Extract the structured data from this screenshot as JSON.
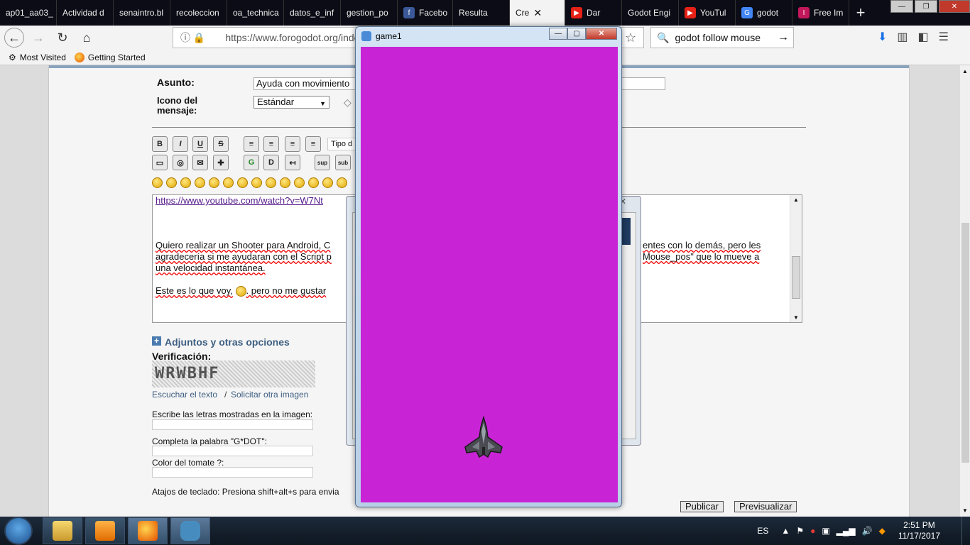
{
  "browser": {
    "tabs": [
      {
        "label": "ap01_aa03_",
        "icon": "",
        "color": "#0c0c16"
      },
      {
        "label": "Actividad d",
        "icon": "",
        "color": "#0c0c16"
      },
      {
        "label": "senaintro.bl",
        "icon": "",
        "color": "#0c0c16"
      },
      {
        "label": "recoleccion",
        "icon": "",
        "color": "#0c0c16"
      },
      {
        "label": "oa_technica",
        "icon": "",
        "color": "#0c0c16"
      },
      {
        "label": "datos_e_inf",
        "icon": "",
        "color": "#0c0c16"
      },
      {
        "label": "gestion_po",
        "icon": "",
        "color": "#0c0c16"
      },
      {
        "label": "Facebo",
        "icon": "f",
        "color": "#3b5998"
      },
      {
        "label": "Resulta",
        "icon": "",
        "color": "#478cbf"
      },
      {
        "label": "Cre",
        "icon": "",
        "color": "#478cbf"
      },
      {
        "label": "Dar",
        "icon": "▶",
        "color": "#e62117"
      },
      {
        "label": "Godot Engi",
        "icon": "",
        "color": "#0c0c16"
      },
      {
        "label": "YouTul",
        "icon": "▶",
        "color": "#e62117"
      },
      {
        "label": "godot",
        "icon": "G",
        "color": "#4285f4"
      },
      {
        "label": "Free Im",
        "icon": "I",
        "color": "#c2185b"
      }
    ],
    "new_tab": "+",
    "url": "https://www.forogodot.org/index.",
    "search_value": "godot follow mouse",
    "bookmarks": [
      "Most Visited",
      "Getting Started"
    ]
  },
  "form": {
    "subject_label": "Asunto:",
    "subject_value": "Ayuda con movimiento",
    "icon_label_1": "Icono del",
    "icon_label_2": "mensaje:",
    "icon_select": "Estándar",
    "font_type": "Tipo d",
    "sup": "sup",
    "sub": "sub",
    "editor": {
      "line1": "https://www.youtube.com/watch?v=W7Nt",
      "line2": "Quiero realizar un Shooter para Android, C",
      "line2_right": "entes con lo demás, pero les",
      "line3": "agradecería si me ayudaran con el Script p",
      "line3_right": "Mouse_pos\" que lo mueve a",
      "line4": "una velocidad instantánea.",
      "line5": "Este es lo que voy,",
      "line5_b": ". pero no me gustar"
    },
    "attachments": "Adjuntos y otras opciones",
    "verification": "Verificación:",
    "captcha_text": "WRWBHF",
    "listen": "Escuchar el texto",
    "slash": "/",
    "another_image": "Solicitar otra imagen",
    "q1": "Escribe las letras mostradas en la imagen:",
    "q2": "Completa la palabra \"G*DOT\":",
    "q3": "Color del tomate ?:",
    "shortcuts": "Atajos de teclado: Presiona shift+alt+s para envia",
    "publish": "Publicar",
    "preview": "Previsualizar"
  },
  "game_window": {
    "title": "game1",
    "canvas_color": "#c824d6"
  },
  "taskbar": {
    "lang": "ES",
    "time": "2:51 PM",
    "date": "11/17/2017"
  }
}
